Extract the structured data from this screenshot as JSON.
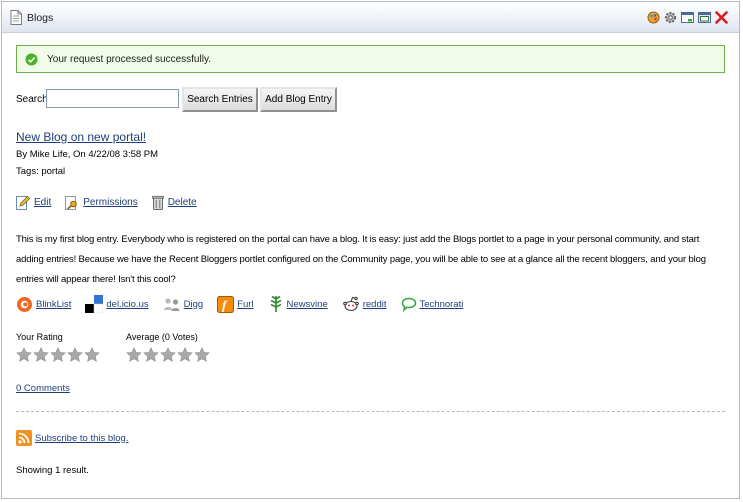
{
  "portlet": {
    "title": "Blogs",
    "title_icon": "document-icon",
    "toolbar_icons": [
      "look-and-feel-icon",
      "configuration-icon",
      "minimize-icon",
      "maximize-icon",
      "close-icon"
    ]
  },
  "success_message": "Your request processed successfully.",
  "search": {
    "label": "Search",
    "value": "",
    "search_button": "Search Entries",
    "add_button": "Add Blog Entry"
  },
  "entry": {
    "title": "New Blog on new portal!",
    "byline": "By Mike Life, On 4/22/08 3:58 PM",
    "tags": "Tags: portal",
    "actions": {
      "edit": "Edit",
      "permissions": "Permissions",
      "delete": "Delete"
    },
    "body": "This is my first blog entry. Everybody who is registered on the portal can have a blog. It is easy: just add the Blogs portlet to a page in your personal community, and start adding entries! Because we have the Recent Bloggers portlet configured on the Community page, you will be able to see at a glance all the recent bloggers, and your blog entries will appear there! Isn't this cool?"
  },
  "social": [
    "BlinkList",
    "del.icio.us",
    "Digg",
    "Furl",
    "Newsvine",
    "reddit",
    "Technorati"
  ],
  "ratings": {
    "your_rating_label": "Your Rating",
    "your_rating_stars": 0,
    "average_label": "Average (0 Votes)",
    "average_stars": 0,
    "max_stars": 5
  },
  "comments_link": "0 Comments",
  "subscribe_link": "Subscribe to this blog.",
  "results_text": "Showing 1 result.",
  "colors": {
    "link": "#1f3f7a",
    "success_border": "#6bb04a",
    "success_bg": "#f0fbe8",
    "star_empty": "#a8a8a8"
  }
}
